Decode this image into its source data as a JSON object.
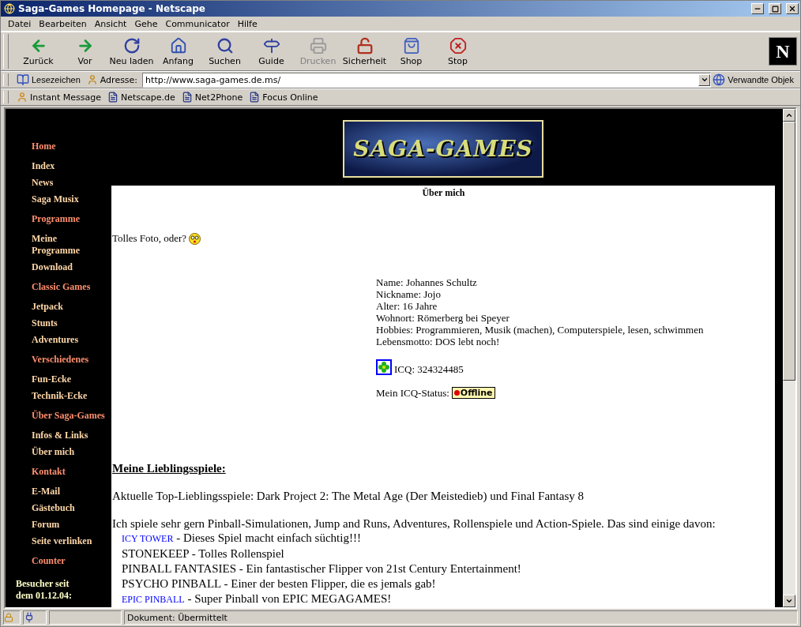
{
  "window": {
    "title": "Saga-Games Homepage - Netscape"
  },
  "menu": [
    "Datei",
    "Bearbeiten",
    "Ansicht",
    "Gehe",
    "Communicator",
    "Hilfe"
  ],
  "toolbar": [
    {
      "label": "Zurück",
      "kind": "back",
      "disabled": false
    },
    {
      "label": "Vor",
      "kind": "forward",
      "disabled": false
    },
    {
      "label": "Neu laden",
      "kind": "reload",
      "disabled": false
    },
    {
      "label": "Anfang",
      "kind": "home",
      "disabled": false
    },
    {
      "label": "Suchen",
      "kind": "search",
      "disabled": false
    },
    {
      "label": "Guide",
      "kind": "guide",
      "disabled": false
    },
    {
      "label": "Drucken",
      "kind": "print",
      "disabled": true
    },
    {
      "label": "Sicherheit",
      "kind": "security",
      "disabled": false
    },
    {
      "label": "Shop",
      "kind": "shop",
      "disabled": false
    },
    {
      "label": "Stop",
      "kind": "stop",
      "disabled": false
    }
  ],
  "location": {
    "bookmarks": "Lesezeichen",
    "label": "Adresse:",
    "url": "http://www.saga-games.de.ms/",
    "related": "Verwandte Objek"
  },
  "brand_logo": "N",
  "personal_toolbar": [
    {
      "label": "Instant Message",
      "kind": "person"
    },
    {
      "label": "Netscape.de",
      "kind": "page"
    },
    {
      "label": "Net2Phone",
      "kind": "page"
    },
    {
      "label": "Focus Online",
      "kind": "page"
    }
  ],
  "logo": {
    "text": "SAGA-GAMES"
  },
  "nav": [
    {
      "label": "Home",
      "kind": "section"
    },
    {
      "label": "Index",
      "kind": "link"
    },
    {
      "label": "News",
      "kind": "link"
    },
    {
      "label": "Saga Musix",
      "kind": "link"
    },
    {
      "label": "Programme",
      "kind": "section"
    },
    {
      "label": "Meine Programme",
      "kind": "link"
    },
    {
      "label": "Download",
      "kind": "link"
    },
    {
      "label": "Classic Games",
      "kind": "section"
    },
    {
      "label": "Jetpack",
      "kind": "link"
    },
    {
      "label": "Stunts",
      "kind": "link"
    },
    {
      "label": "Adventures",
      "kind": "link"
    },
    {
      "label": "Verschiedenes",
      "kind": "section"
    },
    {
      "label": "Fun-Ecke",
      "kind": "link"
    },
    {
      "label": "Technik-Ecke",
      "kind": "link"
    },
    {
      "label": "Über Saga-Games",
      "kind": "section"
    },
    {
      "label": "Infos & Links",
      "kind": "link"
    },
    {
      "label": "Über mich",
      "kind": "link"
    },
    {
      "label": "Kontakt",
      "kind": "section"
    },
    {
      "label": "E-Mail",
      "kind": "link"
    },
    {
      "label": "Gästebuch",
      "kind": "link"
    },
    {
      "label": "Forum",
      "kind": "link"
    },
    {
      "label": "Seite verlinken",
      "kind": "link"
    },
    {
      "label": "Counter",
      "kind": "section"
    }
  ],
  "visitors": "Besucher seit dem 01.12.04:",
  "page": {
    "heading": "Über mich",
    "photo_caption": "Tolles Foto, oder?",
    "profile": [
      "Name: Johannes Schultz",
      "Nickname: Jojo",
      "Alter: 16 Jahre",
      "Wohnort: Römerberg bei Speyer",
      "Hobbies: Programmieren, Musik (machen), Computerspiele, lesen, schwimmen",
      "Lebensmotto: DOS lebt noch!"
    ],
    "icq": "ICQ: 324324485",
    "icq_status_label": "Mein ICQ-Status:",
    "icq_status": "Offline",
    "favorites_heading": "Meine Lieblingsspiele:",
    "top_favorites": "Aktuelle Top-Lieblingsspiele: Dark Project 2: The Metal Age (Der Meistedieb) und Final Fantasy 8",
    "intro": "Ich spiele sehr gern Pinball-Simulationen, Jump and Runs, Adventures, Rollenspiele und Action-Spiele. Das sind einige davon:",
    "games": [
      {
        "title": "ICY TOWER",
        "kind": "link",
        "text": " - Dieses Spiel macht einfach süchtig!!!"
      },
      {
        "title": "STONEKEEP",
        "kind": "plain",
        "text": " - Tolles Rollenspiel"
      },
      {
        "title": "PINBALL FANTASIES",
        "kind": "plain",
        "text": " - Ein fantastischer Flipper von 21st Century Entertainment!"
      },
      {
        "title": "PSYCHO PINBALL",
        "kind": "plain",
        "text": " - Einer der besten Flipper, die es jemals gab!"
      },
      {
        "title": "EPIC PINBALL",
        "kind": "link",
        "text": " - Super Pinball von EPIC MEGAGAMES!"
      }
    ]
  },
  "status_bar": {
    "text": "Dokument: Übermittelt"
  }
}
